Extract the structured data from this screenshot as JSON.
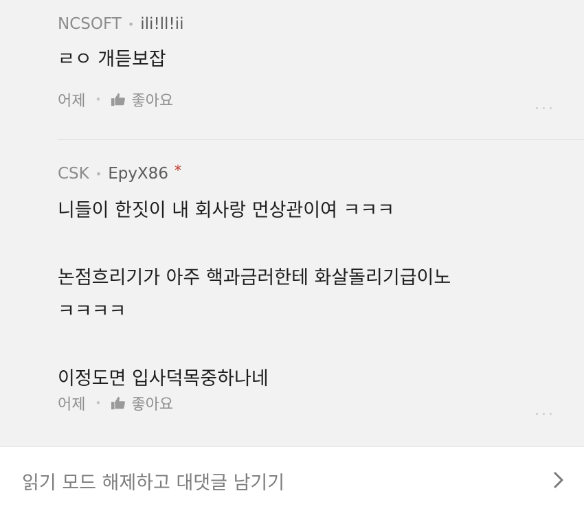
{
  "comments": [
    {
      "company": "NCSOFT",
      "nickname": "ili!ll!ii",
      "body": "ㄹㅇ 개듣보잡",
      "time": "어제",
      "like_label": "좋아요",
      "more": "...",
      "badge": ""
    },
    {
      "company": "CSK",
      "nickname": "EpyX86",
      "badge": "*",
      "body": "니들이 한짓이 내 회사랑 먼상관이여 ㅋㅋㅋ\n\n논점흐리기가 아주 핵과금러한테 화살돌리기급이노\nㅋㅋㅋㅋ\n\n이정도면 입사덕목중하나네",
      "time": "어제",
      "like_label": "좋아요",
      "more": "..."
    }
  ],
  "bottom_bar": {
    "label": "읽기 모드 해제하고 대댓글 남기기"
  },
  "icons": {
    "like": "thumbs-up-icon",
    "more": "more-options-icon",
    "chevron": "chevron-right-icon"
  },
  "colors": {
    "background": "#f2f2f2",
    "badge": "#c0392b"
  }
}
